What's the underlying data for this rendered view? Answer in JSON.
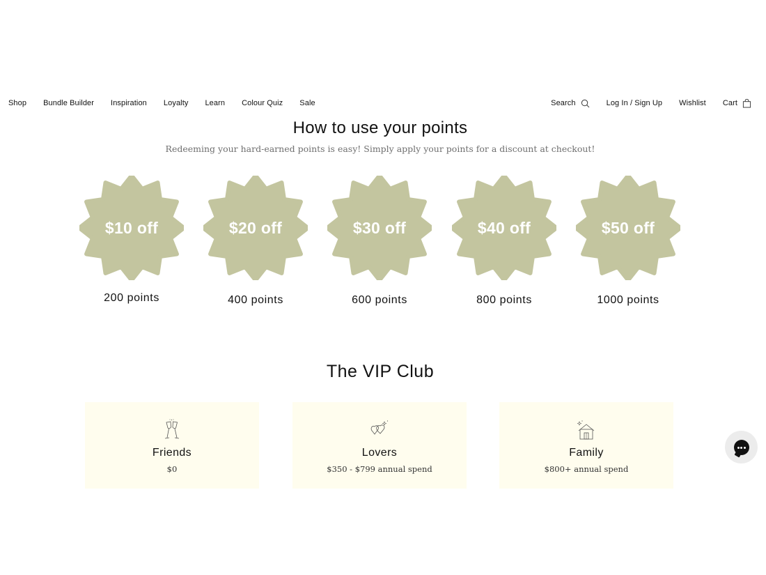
{
  "nav": {
    "left": [
      "Shop",
      "Bundle Builder",
      "Inspiration",
      "Loyalty",
      "Learn",
      "Colour Quiz",
      "Sale"
    ],
    "search_label": "Search",
    "login_label": "Log In / Sign Up",
    "wishlist_label": "Wishlist",
    "cart_label": "Cart"
  },
  "points": {
    "title": "How to use your points",
    "subtitle": "Redeeming your hard-earned points is easy! Simply apply your points for a discount at checkout!",
    "badge_color": "#c3c59f",
    "rewards": [
      {
        "discount": "$10 off",
        "points": "200 points"
      },
      {
        "discount": "$20 off",
        "points": "400 points"
      },
      {
        "discount": "$30 off",
        "points": "600 points"
      },
      {
        "discount": "$40 off",
        "points": "800 points"
      },
      {
        "discount": "$50 off",
        "points": "1000 points"
      }
    ]
  },
  "vip": {
    "title": "The VIP Club",
    "tier_bg": "#fffdee",
    "tiers": [
      {
        "name": "Friends",
        "spend": "$0",
        "icon": "champagne-glasses-icon"
      },
      {
        "name": "Lovers",
        "spend": "$350 - $799 annual spend",
        "icon": "hearts-icon"
      },
      {
        "name": "Family",
        "spend": "$800+ annual spend",
        "icon": "house-icon"
      }
    ]
  },
  "chat": {
    "icon": "chat-icon"
  }
}
